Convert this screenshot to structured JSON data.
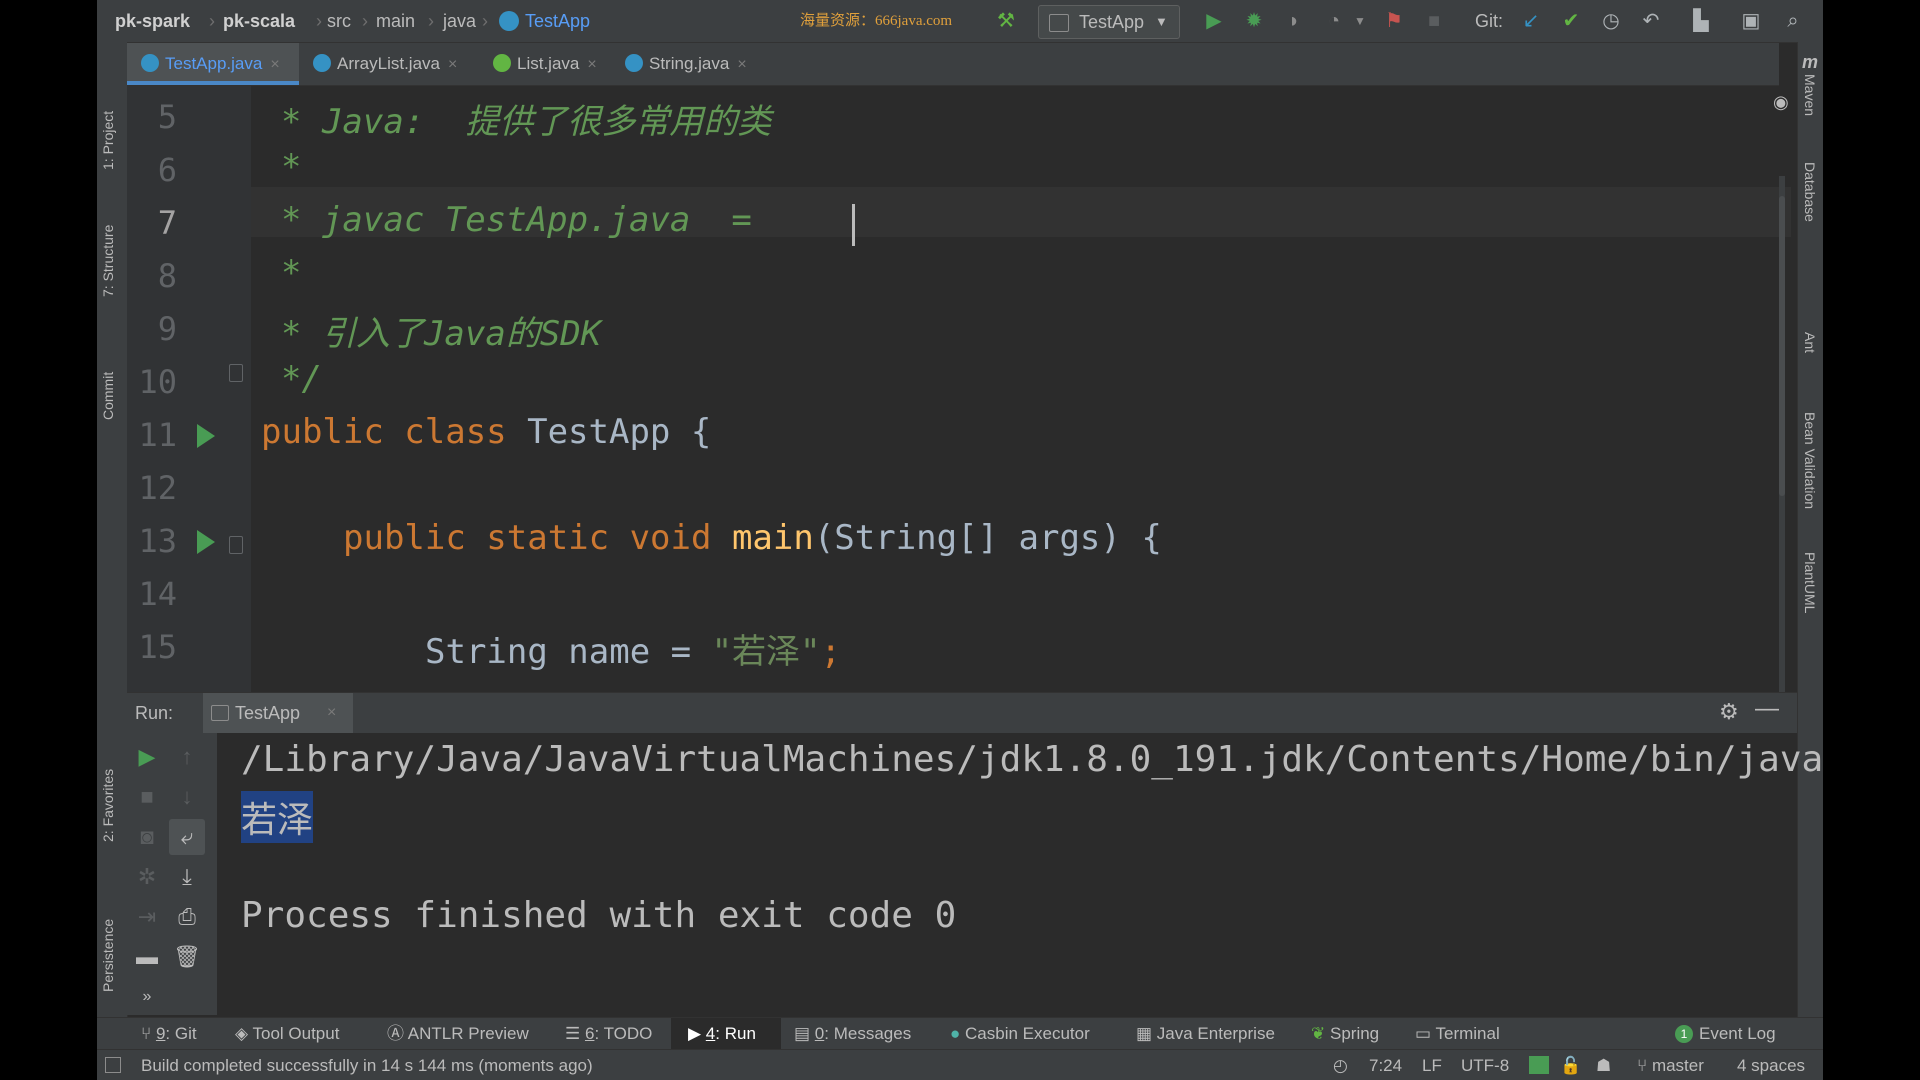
{
  "breadcrumb": {
    "items": [
      "pk-spark",
      "pk-scala",
      "src",
      "main",
      "java",
      "TestApp"
    ]
  },
  "watermark": "海量资源：666java.com",
  "toolbar": {
    "run_config": "TestApp",
    "git_label": "Git:"
  },
  "tabs": [
    {
      "label": "TestApp.java",
      "active": true
    },
    {
      "label": "ArrayList.java"
    },
    {
      "label": "List.java"
    },
    {
      "label": "String.java"
    }
  ],
  "left_tool_windows": [
    "1: Project",
    "7: Structure",
    "Commit",
    "2: Favorites",
    "Persistence"
  ],
  "right_tool_windows": [
    "Maven",
    "Database",
    "Ant",
    "Bean Validation",
    "PlantUML"
  ],
  "editor": {
    "lines": [
      {
        "num": "5",
        "text": "* Java:  提供了很多常用的类"
      },
      {
        "num": "6",
        "text": "*"
      },
      {
        "num": "7",
        "text": "* javac TestApp.java  ="
      },
      {
        "num": "8",
        "text": "*"
      },
      {
        "num": "9",
        "text": "* 引入了Java的SDK"
      },
      {
        "num": "10",
        "text": "*/"
      },
      {
        "num": "11",
        "kw": "public class ",
        "rest": "TestApp {"
      },
      {
        "num": "12",
        "text": ""
      },
      {
        "num": "13",
        "kw": "public static void ",
        "fn": "main",
        "rest": "(String[] args) {"
      },
      {
        "num": "14",
        "text": ""
      },
      {
        "num": "15",
        "pre": "String name = ",
        "str": "\"若泽\"",
        "post": ";"
      }
    ]
  },
  "run": {
    "label": "Run:",
    "tab": "TestApp",
    "output": [
      "/Library/Java/JavaVirtualMachines/jdk1.8.0_191.jdk/Contents/Home/bin/java ..",
      "若泽",
      "",
      "Process finished with exit code 0"
    ]
  },
  "bottom_tools": [
    {
      "num": "9",
      "label": ": Git"
    },
    {
      "num": "",
      "label": "Tool Output"
    },
    {
      "num": "",
      "label": "ANTLR Preview"
    },
    {
      "num": "6",
      "label": ": TODO"
    },
    {
      "num": "4",
      "label": ": Run"
    },
    {
      "num": "0",
      "label": ": Messages"
    },
    {
      "num": "",
      "label": "Casbin Executor"
    },
    {
      "num": "",
      "label": "Java Enterprise"
    },
    {
      "num": "",
      "label": "Spring"
    },
    {
      "num": "",
      "label": "Terminal"
    }
  ],
  "event_log": {
    "count": "1",
    "label": "Event Log"
  },
  "status": {
    "message": "Build completed successfully in 14 s 144 ms (moments ago)",
    "position": "7:24",
    "line_sep": "LF",
    "encoding": "UTF-8",
    "branch": "master",
    "indent": "4 spaces"
  },
  "colors": {
    "background": "#2b2b2b",
    "panel": "#3c3f41",
    "keyword": "#cc7832",
    "comment": "#629755",
    "string": "#6a8759",
    "run_green": "#499c54",
    "accent_blue": "#4a88c7"
  }
}
